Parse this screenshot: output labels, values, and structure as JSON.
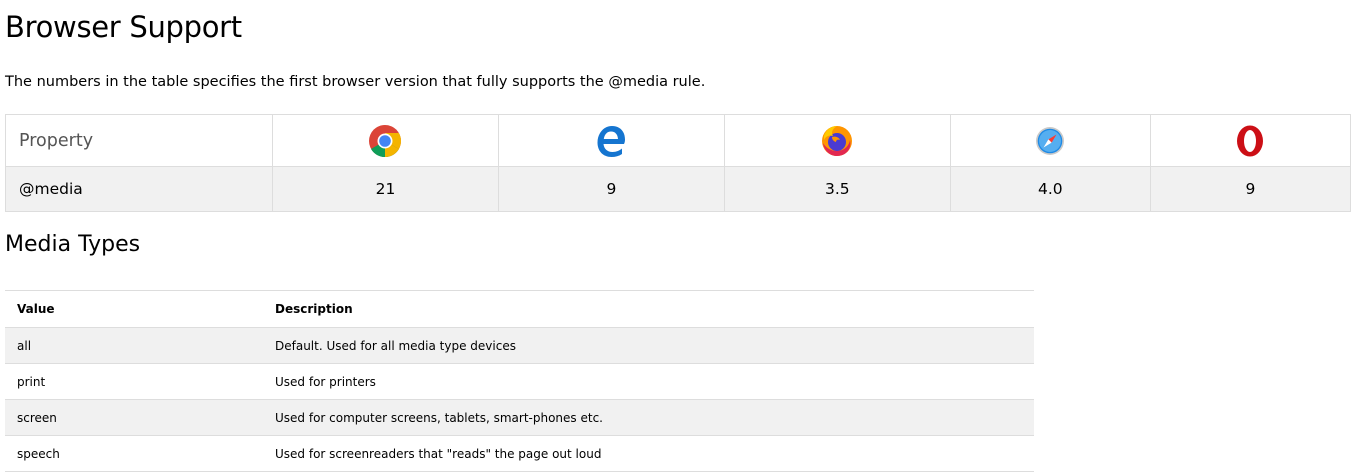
{
  "browser_support": {
    "title": "Browser Support",
    "intro": "The numbers in the table specifies the first browser version that fully supports the @media rule.",
    "header_label": "Property",
    "browsers": [
      {
        "icon": "chrome-icon"
      },
      {
        "icon": "edge-icon"
      },
      {
        "icon": "firefox-icon"
      },
      {
        "icon": "safari-icon"
      },
      {
        "icon": "opera-icon"
      }
    ],
    "row": {
      "property": "@media",
      "versions": [
        "21",
        "9",
        "3.5",
        "4.0",
        "9"
      ]
    }
  },
  "media_types": {
    "title": "Media Types",
    "columns": [
      "Value",
      "Description"
    ],
    "rows": [
      {
        "value": "all",
        "description": "Default. Used for all media type devices"
      },
      {
        "value": "print",
        "description": "Used for printers"
      },
      {
        "value": "screen",
        "description": "Used for computer screens, tablets, smart-phones etc."
      },
      {
        "value": "speech",
        "description": "Used for screenreaders that \"reads\" the page out loud"
      }
    ]
  },
  "colors": {
    "row_alt_bg": "#f1f1f1",
    "border": "#dddddd",
    "header_label": "#555555"
  }
}
